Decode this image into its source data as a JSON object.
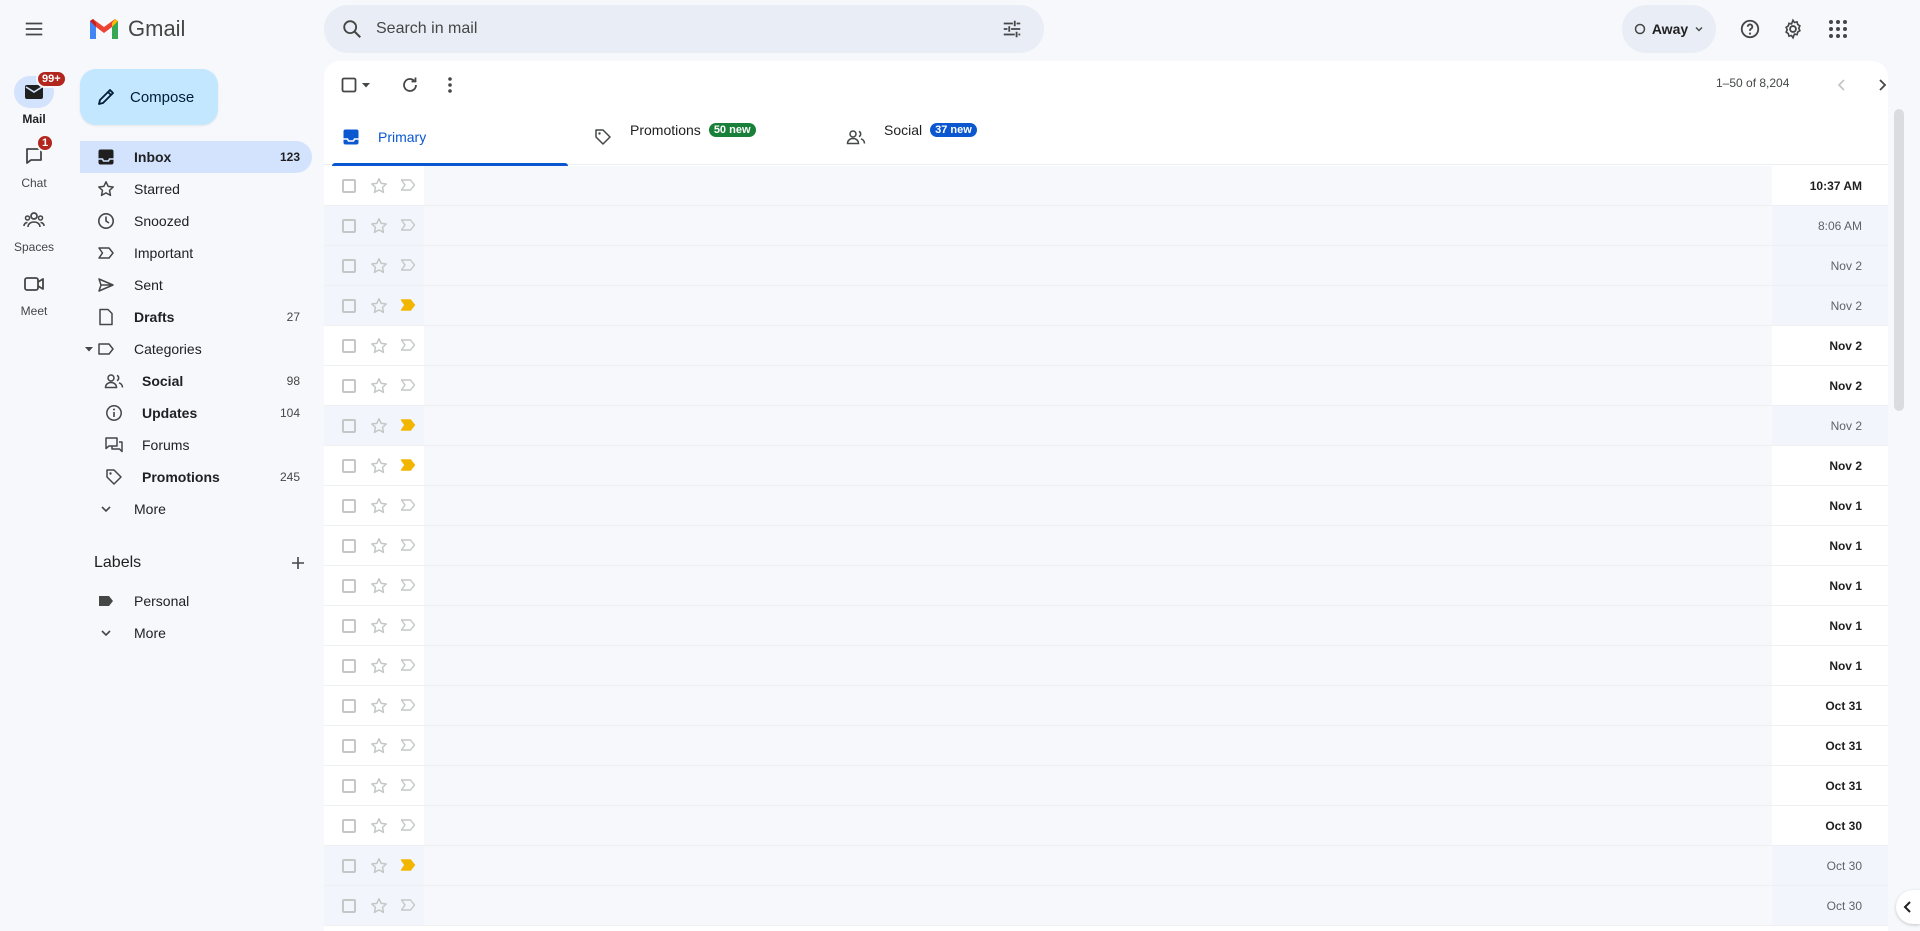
{
  "app": {
    "name": "Gmail"
  },
  "search": {
    "placeholder": "Search in mail"
  },
  "status": {
    "label": "Away"
  },
  "rail": [
    {
      "label": "Mail",
      "badge": "99+",
      "icon": "mail-icon",
      "active": true
    },
    {
      "label": "Chat",
      "badge": "1",
      "icon": "chat-icon",
      "active": false
    },
    {
      "label": "Spaces",
      "badge": "",
      "icon": "spaces-icon",
      "active": false
    },
    {
      "label": "Meet",
      "badge": "",
      "icon": "meet-icon",
      "active": false
    }
  ],
  "compose": {
    "label": "Compose"
  },
  "nav": {
    "inbox": {
      "label": "Inbox",
      "count": "123"
    },
    "starred": {
      "label": "Starred"
    },
    "snoozed": {
      "label": "Snoozed"
    },
    "important": {
      "label": "Important"
    },
    "sent": {
      "label": "Sent"
    },
    "drafts": {
      "label": "Drafts",
      "count": "27"
    },
    "categories": {
      "label": "Categories"
    },
    "social": {
      "label": "Social",
      "count": "98"
    },
    "updates": {
      "label": "Updates",
      "count": "104"
    },
    "forums": {
      "label": "Forums"
    },
    "promotions": {
      "label": "Promotions",
      "count": "245"
    },
    "more": {
      "label": "More"
    }
  },
  "labels": {
    "title": "Labels",
    "personal": "Personal",
    "more": "More"
  },
  "toolbar": {
    "pager": "1–50 of 8,204"
  },
  "tabs": {
    "primary": {
      "label": "Primary"
    },
    "promotions": {
      "label": "Promotions",
      "badge": "50 new",
      "badge_color": "#188038"
    },
    "social": {
      "label": "Social",
      "badge": "37 new",
      "badge_color": "#0b57d0"
    }
  },
  "emails": [
    {
      "date": "10:37 AM",
      "unread": true,
      "important": false
    },
    {
      "date": "8:06 AM",
      "unread": false,
      "important": false
    },
    {
      "date": "Nov 2",
      "unread": false,
      "important": false
    },
    {
      "date": "Nov 2",
      "unread": false,
      "important": true
    },
    {
      "date": "Nov 2",
      "unread": true,
      "important": false
    },
    {
      "date": "Nov 2",
      "unread": true,
      "important": false
    },
    {
      "date": "Nov 2",
      "unread": false,
      "important": true
    },
    {
      "date": "Nov 2",
      "unread": true,
      "important": true
    },
    {
      "date": "Nov 1",
      "unread": true,
      "important": false
    },
    {
      "date": "Nov 1",
      "unread": true,
      "important": false
    },
    {
      "date": "Nov 1",
      "unread": true,
      "important": false
    },
    {
      "date": "Nov 1",
      "unread": true,
      "important": false
    },
    {
      "date": "Nov 1",
      "unread": true,
      "important": false
    },
    {
      "date": "Oct 31",
      "unread": true,
      "important": false
    },
    {
      "date": "Oct 31",
      "unread": true,
      "important": false
    },
    {
      "date": "Oct 31",
      "unread": true,
      "important": false
    },
    {
      "date": "Oct 30",
      "unread": true,
      "important": false
    },
    {
      "date": "Oct 30",
      "unread": false,
      "important": true
    },
    {
      "date": "Oct 30",
      "unread": false,
      "important": false
    }
  ],
  "colors": {
    "accent": "#0b57d0",
    "compose_bg": "#c2e7ff",
    "important_marker": "#f2b600"
  }
}
